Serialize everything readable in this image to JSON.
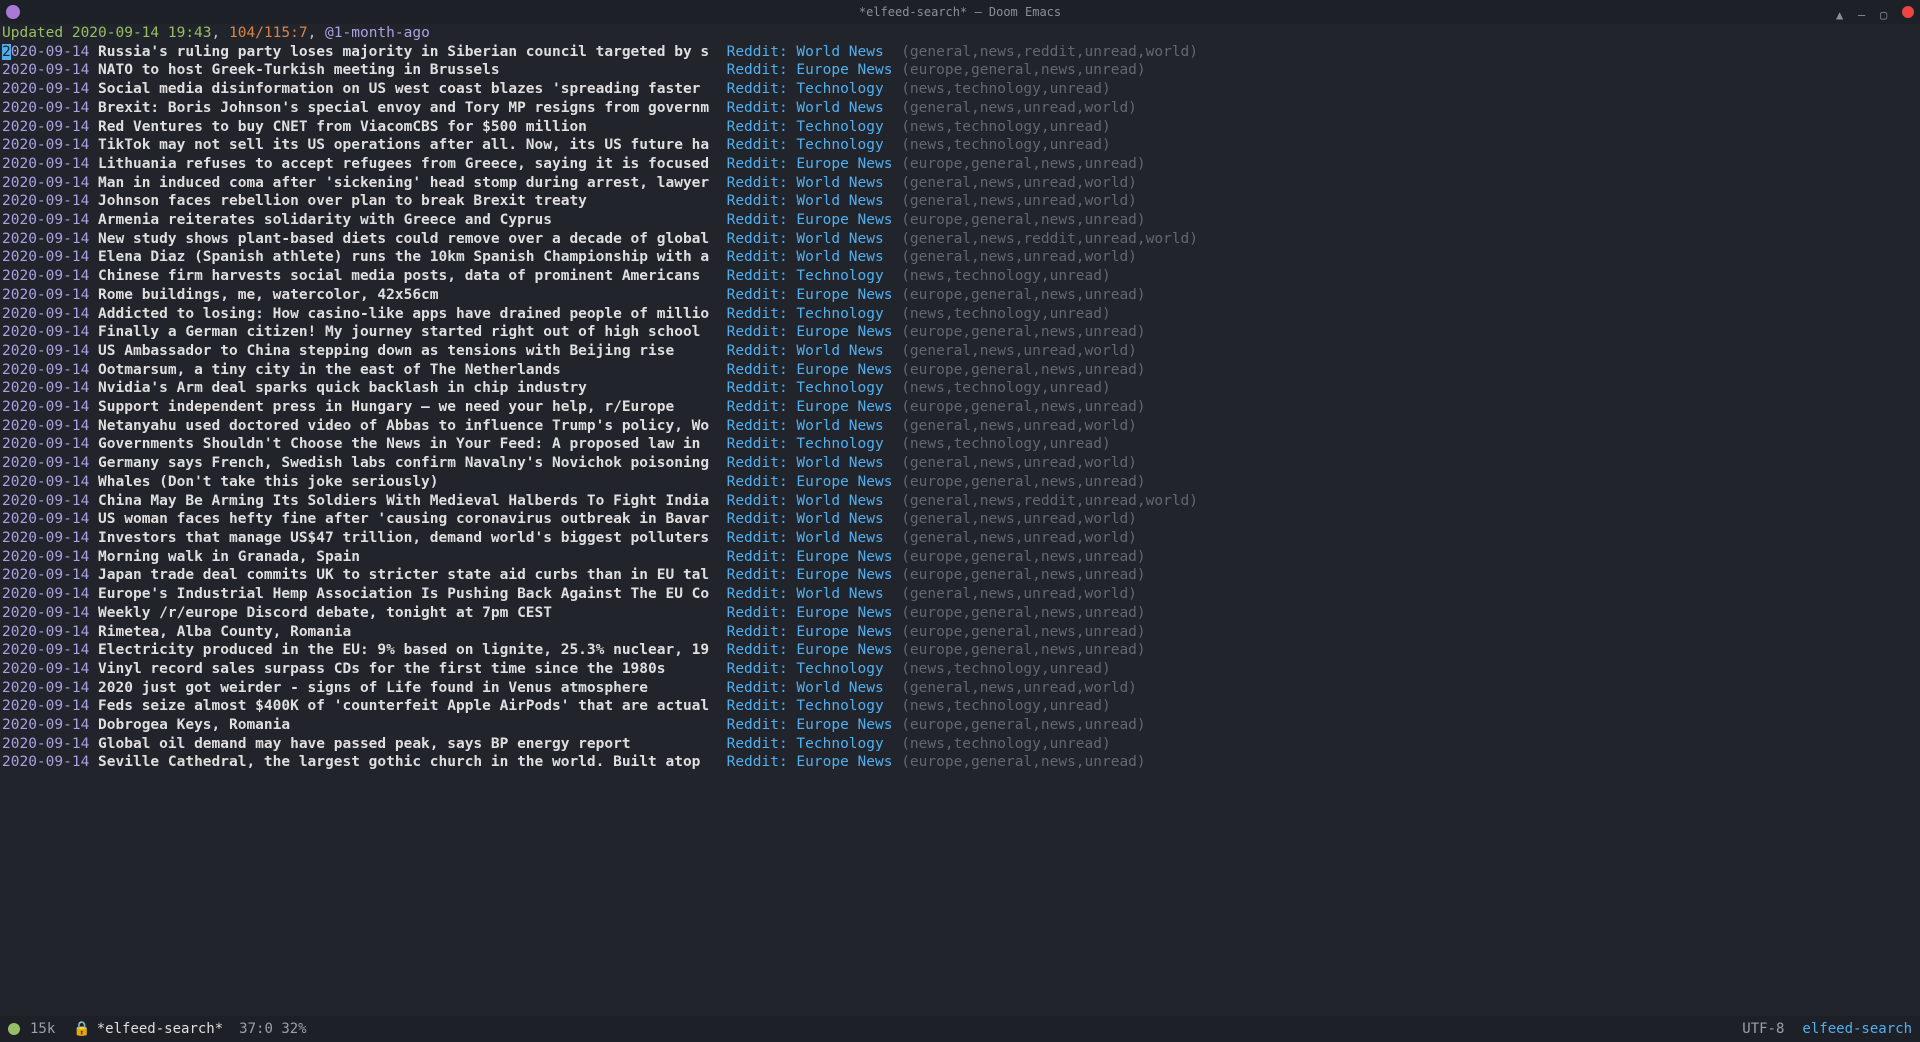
{
  "window": {
    "title": "*elfeed-search* – Doom Emacs"
  },
  "header": {
    "updated_label": "Updated ",
    "updated_time": "2020-09-14 19:43",
    "count": "104/115:7",
    "filter": "@1-month-ago"
  },
  "feeds": {
    "world": "Reddit: World News",
    "europe": "Reddit: Europe News",
    "tech": "Reddit: Technology"
  },
  "tagsets": {
    "world_unread": "general,news,unread,world",
    "world_reddit_unread": "general,news,reddit,unread,world",
    "europe_unread": "europe,general,news,unread",
    "tech_unread": "news,technology,unread"
  },
  "entries": [
    {
      "date": "2020-09-14",
      "title": "Russia's ruling party loses majority in Siberian council targeted by s",
      "feed": "world",
      "tags": "world_reddit_unread",
      "cursor": true
    },
    {
      "date": "2020-09-14",
      "title": "NATO to host Greek-Turkish meeting in Brussels",
      "feed": "europe",
      "tags": "europe_unread"
    },
    {
      "date": "2020-09-14",
      "title": "Social media disinformation on US west coast blazes 'spreading faster",
      "feed": "tech",
      "tags": "tech_unread"
    },
    {
      "date": "2020-09-14",
      "title": "Brexit: Boris Johnson's special envoy and Tory MP resigns from governm",
      "feed": "world",
      "tags": "world_unread"
    },
    {
      "date": "2020-09-14",
      "title": "Red Ventures to buy CNET from ViacomCBS for $500 million",
      "feed": "tech",
      "tags": "tech_unread"
    },
    {
      "date": "2020-09-14",
      "title": "TikTok may not sell its US operations after all. Now, its US future ha",
      "feed": "tech",
      "tags": "tech_unread"
    },
    {
      "date": "2020-09-14",
      "title": "Lithuania refuses to accept refugees from Greece, saying it is focused",
      "feed": "europe",
      "tags": "europe_unread"
    },
    {
      "date": "2020-09-14",
      "title": "Man in induced coma after 'sickening' head stomp during arrest, lawyer",
      "feed": "world",
      "tags": "world_unread"
    },
    {
      "date": "2020-09-14",
      "title": "Johnson faces rebellion over plan to break Brexit treaty",
      "feed": "world",
      "tags": "world_unread"
    },
    {
      "date": "2020-09-14",
      "title": "Armenia reiterates solidarity with Greece and Cyprus",
      "feed": "europe",
      "tags": "europe_unread"
    },
    {
      "date": "2020-09-14",
      "title": "New study shows plant-based diets could remove over a decade of global",
      "feed": "world",
      "tags": "world_reddit_unread"
    },
    {
      "date": "2020-09-14",
      "title": "Elena Diaz (Spanish athlete) runs the 10km Spanish Championship with a",
      "feed": "world",
      "tags": "world_unread"
    },
    {
      "date": "2020-09-14",
      "title": "Chinese firm harvests social media posts, data of prominent Americans",
      "feed": "tech",
      "tags": "tech_unread"
    },
    {
      "date": "2020-09-14",
      "title": "Rome buildings, me, watercolor, 42x56cm",
      "feed": "europe",
      "tags": "europe_unread"
    },
    {
      "date": "2020-09-14",
      "title": "Addicted to losing: How casino-like apps have drained people of millio",
      "feed": "tech",
      "tags": "tech_unread"
    },
    {
      "date": "2020-09-14",
      "title": "Finally a German citizen! My journey started right out of high school",
      "feed": "europe",
      "tags": "europe_unread"
    },
    {
      "date": "2020-09-14",
      "title": "US Ambassador to China stepping down as tensions with Beijing rise",
      "feed": "world",
      "tags": "world_unread"
    },
    {
      "date": "2020-09-14",
      "title": "Ootmarsum, a tiny city in the east of The Netherlands",
      "feed": "europe",
      "tags": "europe_unread"
    },
    {
      "date": "2020-09-14",
      "title": "Nvidia's Arm deal sparks quick backlash in chip industry",
      "feed": "tech",
      "tags": "tech_unread"
    },
    {
      "date": "2020-09-14",
      "title": "Support independent press in Hungary – we need your help, r/Europe",
      "feed": "europe",
      "tags": "europe_unread"
    },
    {
      "date": "2020-09-14",
      "title": "Netanyahu used doctored video of Abbas to influence Trump's policy, Wo",
      "feed": "world",
      "tags": "world_unread"
    },
    {
      "date": "2020-09-14",
      "title": "Governments Shouldn't Choose the News in Your Feed: A proposed law in",
      "feed": "tech",
      "tags": "tech_unread"
    },
    {
      "date": "2020-09-14",
      "title": "Germany says French, Swedish labs confirm Navalny's Novichok poisoning",
      "feed": "world",
      "tags": "world_unread"
    },
    {
      "date": "2020-09-14",
      "title": "Whales (Don't take this joke seriously)",
      "feed": "europe",
      "tags": "europe_unread"
    },
    {
      "date": "2020-09-14",
      "title": "China May Be Arming Its Soldiers With Medieval Halberds To Fight India",
      "feed": "world",
      "tags": "world_reddit_unread"
    },
    {
      "date": "2020-09-14",
      "title": "US woman faces hefty fine after 'causing coronavirus outbreak in Bavar",
      "feed": "world",
      "tags": "world_unread"
    },
    {
      "date": "2020-09-14",
      "title": "Investors that manage US$47 trillion, demand world's biggest polluters",
      "feed": "world",
      "tags": "world_unread"
    },
    {
      "date": "2020-09-14",
      "title": "Morning walk in Granada, Spain",
      "feed": "europe",
      "tags": "europe_unread"
    },
    {
      "date": "2020-09-14",
      "title": "Japan trade deal commits UK to stricter state aid curbs than in EU tal",
      "feed": "europe",
      "tags": "europe_unread"
    },
    {
      "date": "2020-09-14",
      "title": "Europe's Industrial Hemp Association Is Pushing Back Against The EU Co",
      "feed": "world",
      "tags": "world_unread"
    },
    {
      "date": "2020-09-14",
      "title": "Weekly /r/europe Discord debate, tonight at 7pm CEST",
      "feed": "europe",
      "tags": "europe_unread"
    },
    {
      "date": "2020-09-14",
      "title": "Rimetea, Alba County, Romania",
      "feed": "europe",
      "tags": "europe_unread"
    },
    {
      "date": "2020-09-14",
      "title": "Electricity produced in the EU: 9% based on lignite, 25.3% nuclear, 19",
      "feed": "europe",
      "tags": "europe_unread"
    },
    {
      "date": "2020-09-14",
      "title": "Vinyl record sales surpass CDs for the first time since the 1980s",
      "feed": "tech",
      "tags": "tech_unread"
    },
    {
      "date": "2020-09-14",
      "title": "2020 just got weirder - signs of Life found in Venus atmosphere",
      "feed": "world",
      "tags": "world_unread"
    },
    {
      "date": "2020-09-14",
      "title": "Feds seize almost $400K of 'counterfeit Apple AirPods' that are actual",
      "feed": "tech",
      "tags": "tech_unread"
    },
    {
      "date": "2020-09-14",
      "title": "Dobrogea Keys, Romania",
      "feed": "europe",
      "tags": "europe_unread"
    },
    {
      "date": "2020-09-14",
      "title": "Global oil demand may have passed peak, says BP energy report",
      "feed": "tech",
      "tags": "tech_unread"
    },
    {
      "date": "2020-09-14",
      "title": "Seville Cathedral, the largest gothic church in the world. Built atop",
      "feed": "europe",
      "tags": "europe_unread"
    }
  ],
  "modeline": {
    "size": "15k",
    "buffer": "*elfeed-search*",
    "pos": "37:0 32%",
    "encoding": "UTF-8",
    "mode": "elfeed-search"
  },
  "layout": {
    "title_col": 71,
    "feed_col": 19
  }
}
